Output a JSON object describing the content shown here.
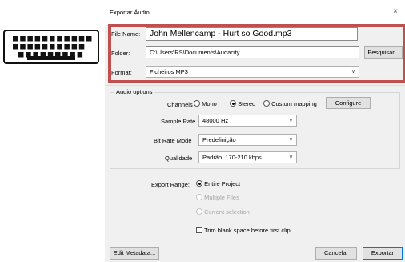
{
  "keyboard_icon": "keyboard-icon",
  "dialog": {
    "title": "Exportar Áudio",
    "close_glyph": "×",
    "file_name_label": "File Name:",
    "file_name_value": "John Mellencamp - Hurt so Good.mp3",
    "folder_label": "Folder:",
    "folder_value": "C:\\Users\\RS\\Documents\\Audacity",
    "browse_label": "Pesquisar...",
    "format_label": "Format:",
    "format_value": "Ficheiros MP3",
    "highlight_color": "#c0504d"
  },
  "audio_options": {
    "title": "Audio options",
    "channels_label": "Channels",
    "mono_label": "Mono",
    "stereo_label": "Stereo",
    "custom_label": "Custom mapping",
    "configure_label": "Configure",
    "channels_selected": "Stereo",
    "sample_rate_label": "Sample Rate",
    "sample_rate_value": "48000 Hz",
    "bit_rate_mode_label": "Bit Rate Mode",
    "bit_rate_mode_value": "Predefinição",
    "quality_label": "Qualidade",
    "quality_value": "Padrão, 170-210 kbps"
  },
  "export_range": {
    "label": "Export Range:",
    "entire_project": "Entire Project",
    "multiple_files": "Multiple Files",
    "current_selection": "Current selection",
    "selected": "Entire Project",
    "trim_label": "Trim blank space before first clip",
    "trim_checked": false
  },
  "footer": {
    "edit_metadata_label": "Edit Metadata...",
    "cancel_label": "Cancelar",
    "export_label": "Exportar"
  }
}
